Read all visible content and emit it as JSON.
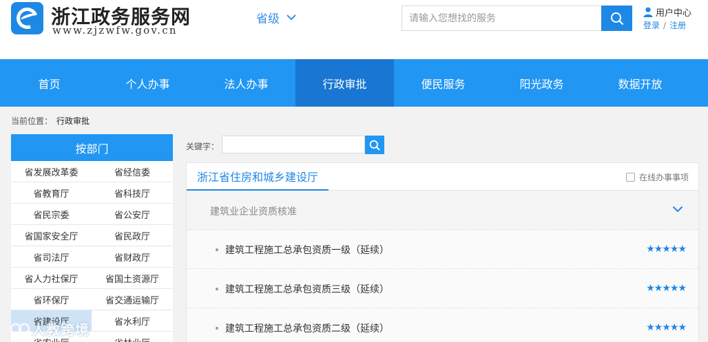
{
  "header": {
    "site_title": "浙江政务服务网",
    "site_url": "www.zjzwfw.gov.cn",
    "region": "省级",
    "search_placeholder": "请输入您想找的服务",
    "user_center": "用户中心",
    "login": "登录",
    "separator": "/",
    "register": "注册"
  },
  "nav": {
    "items": [
      "首页",
      "个人办事",
      "法人办事",
      "行政审批",
      "便民服务",
      "阳光政务",
      "数据开放"
    ],
    "active": "行政审批"
  },
  "breadcrumb": {
    "label": "当前位置：",
    "current": "行政审批"
  },
  "sidebar": {
    "title": "按部门",
    "departments": [
      "省发展改革委",
      "省经信委",
      "省教育厅",
      "省科技厅",
      "省民宗委",
      "省公安厅",
      "省国家安全厅",
      "省民政厅",
      "省司法厅",
      "省财政厅",
      "省人力社保厅",
      "省国土资源厅",
      "省环保厅",
      "省交通运输厅",
      "省建设厅",
      "省水利厅",
      "省农业厅",
      "省林业厅"
    ],
    "highlighted": "省建设厅"
  },
  "keyword": {
    "label": "关键字："
  },
  "panel": {
    "department_tab": "浙江省住房和城乡建设厅",
    "online_toggle": "在线办事事项",
    "category": "建筑业企业资质核准",
    "items": [
      {
        "title": "建筑工程施工总承包资质一级（延续）",
        "stars": "★★★★★",
        "rating": 5
      },
      {
        "title": "建筑工程施工总承包资质三级（延续）",
        "stars": "★★★★★",
        "rating": 5
      },
      {
        "title": "建筑工程施工总承包资质二级（延续）",
        "stars": "★★★★★",
        "rating": 5
      }
    ]
  },
  "watermark": {
    "text": "人教跨境"
  },
  "colors": {
    "brand_blue": "#2196f3",
    "active_nav": "#1976d2",
    "link_blue": "#1e88e5",
    "page_bg": "#f2f2f2"
  }
}
